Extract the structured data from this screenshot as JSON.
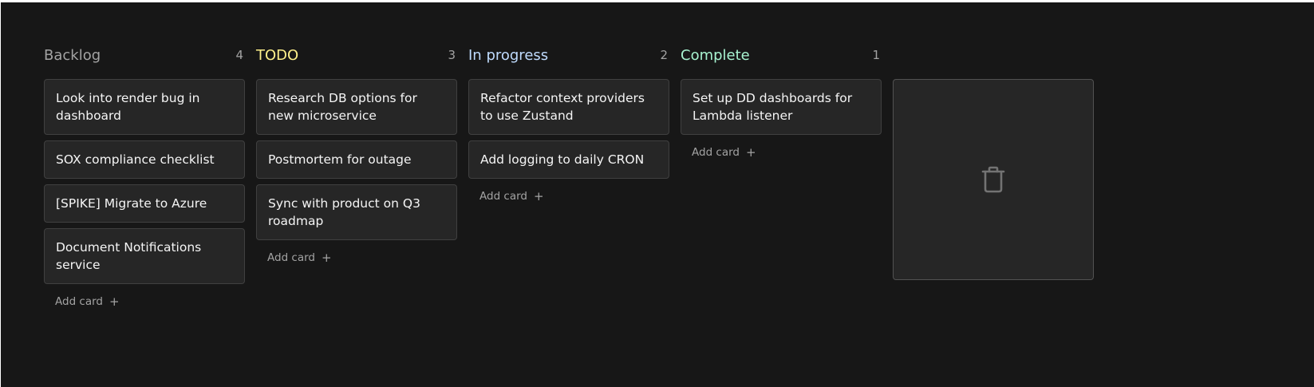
{
  "colors": {
    "background": "#171717",
    "card_bg": "#262626",
    "card_border": "#404040",
    "backlog": "#a3a3a3",
    "todo": "#fef08a",
    "in_progress": "#bfdbfe",
    "complete": "#a7f3d0"
  },
  "add_card_label": "Add card",
  "add_card_icon": "+",
  "trash_icon": "trash-icon",
  "columns": [
    {
      "title": "Backlog",
      "count": "4",
      "cards": [
        "Look into render bug in dashboard",
        "SOX compliance checklist",
        "[SPIKE] Migrate to Azure",
        "Document Notifications service"
      ]
    },
    {
      "title": "TODO",
      "count": "3",
      "cards": [
        "Research DB options for new microservice",
        "Postmortem for outage",
        "Sync with product on Q3 roadmap"
      ]
    },
    {
      "title": "In progress",
      "count": "2",
      "cards": [
        "Refactor context providers to use Zustand",
        "Add logging to daily CRON"
      ]
    },
    {
      "title": "Complete",
      "count": "1",
      "cards": [
        "Set up DD dashboards for Lambda listener"
      ]
    }
  ]
}
